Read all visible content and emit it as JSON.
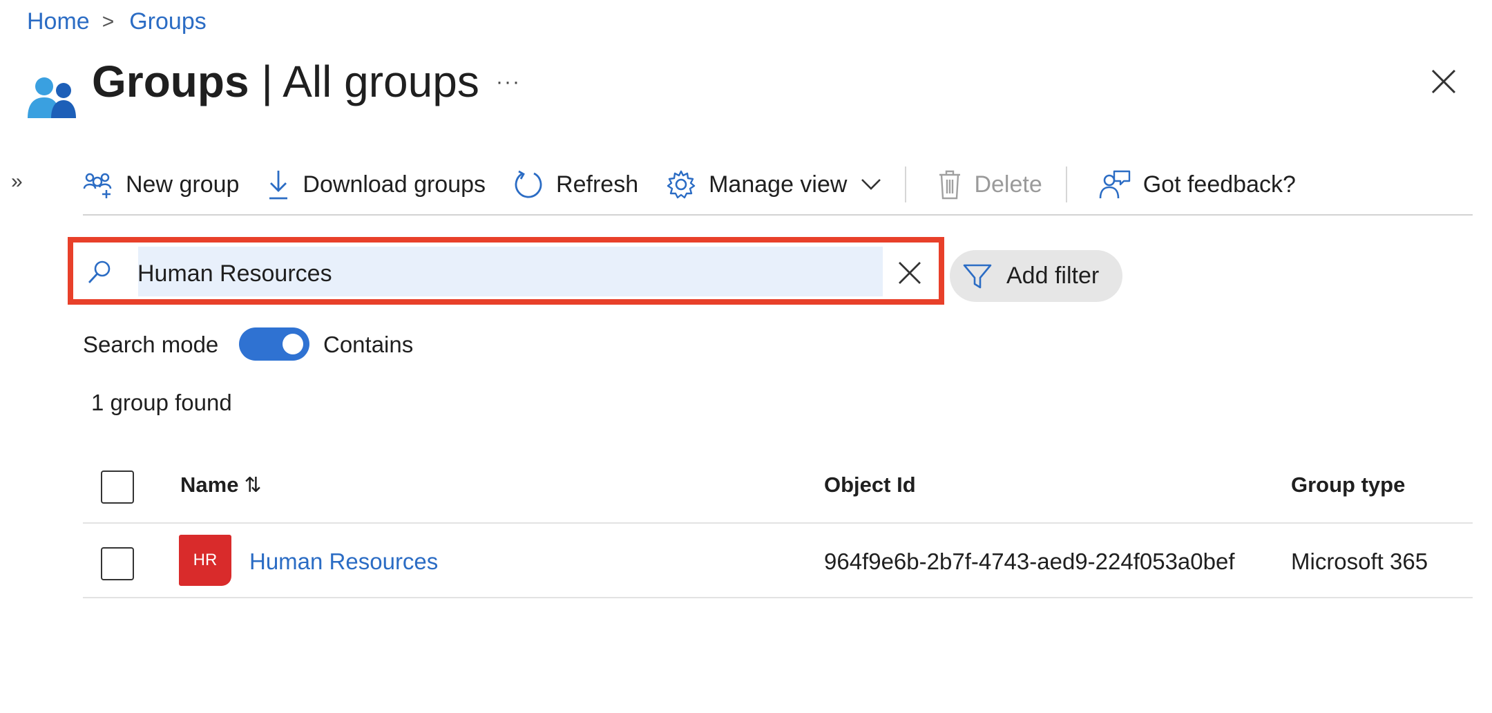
{
  "breadcrumb": {
    "home": "Home",
    "separator": ">",
    "current": "Groups"
  },
  "header": {
    "title_bold": "Groups",
    "title_sep": " | ",
    "title_rest": "All groups",
    "more": "···"
  },
  "expander": "»",
  "toolbar": {
    "new_group": "New group",
    "download_groups": "Download groups",
    "refresh": "Refresh",
    "manage_view": "Manage view",
    "delete": "Delete",
    "feedback": "Got feedback?"
  },
  "search": {
    "value": "Human Resources",
    "add_filter": "Add filter"
  },
  "search_mode": {
    "label": "Search mode",
    "value": "Contains",
    "enabled": true
  },
  "result_count": "1 group found",
  "table": {
    "columns": {
      "name": "Name",
      "sort_icon": "⇅",
      "object_id": "Object Id",
      "group_type": "Group type"
    },
    "rows": [
      {
        "initials": "HR",
        "name": "Human Resources",
        "object_id": "964f9e6b-2b7f-4743-aed9-224f053a0bef",
        "group_type": "Microsoft 365"
      }
    ]
  },
  "colors": {
    "accent": "#2b6cc4",
    "highlight_border": "#e8402a",
    "avatar": "#d92b2b",
    "toggle": "#2f72d2"
  }
}
